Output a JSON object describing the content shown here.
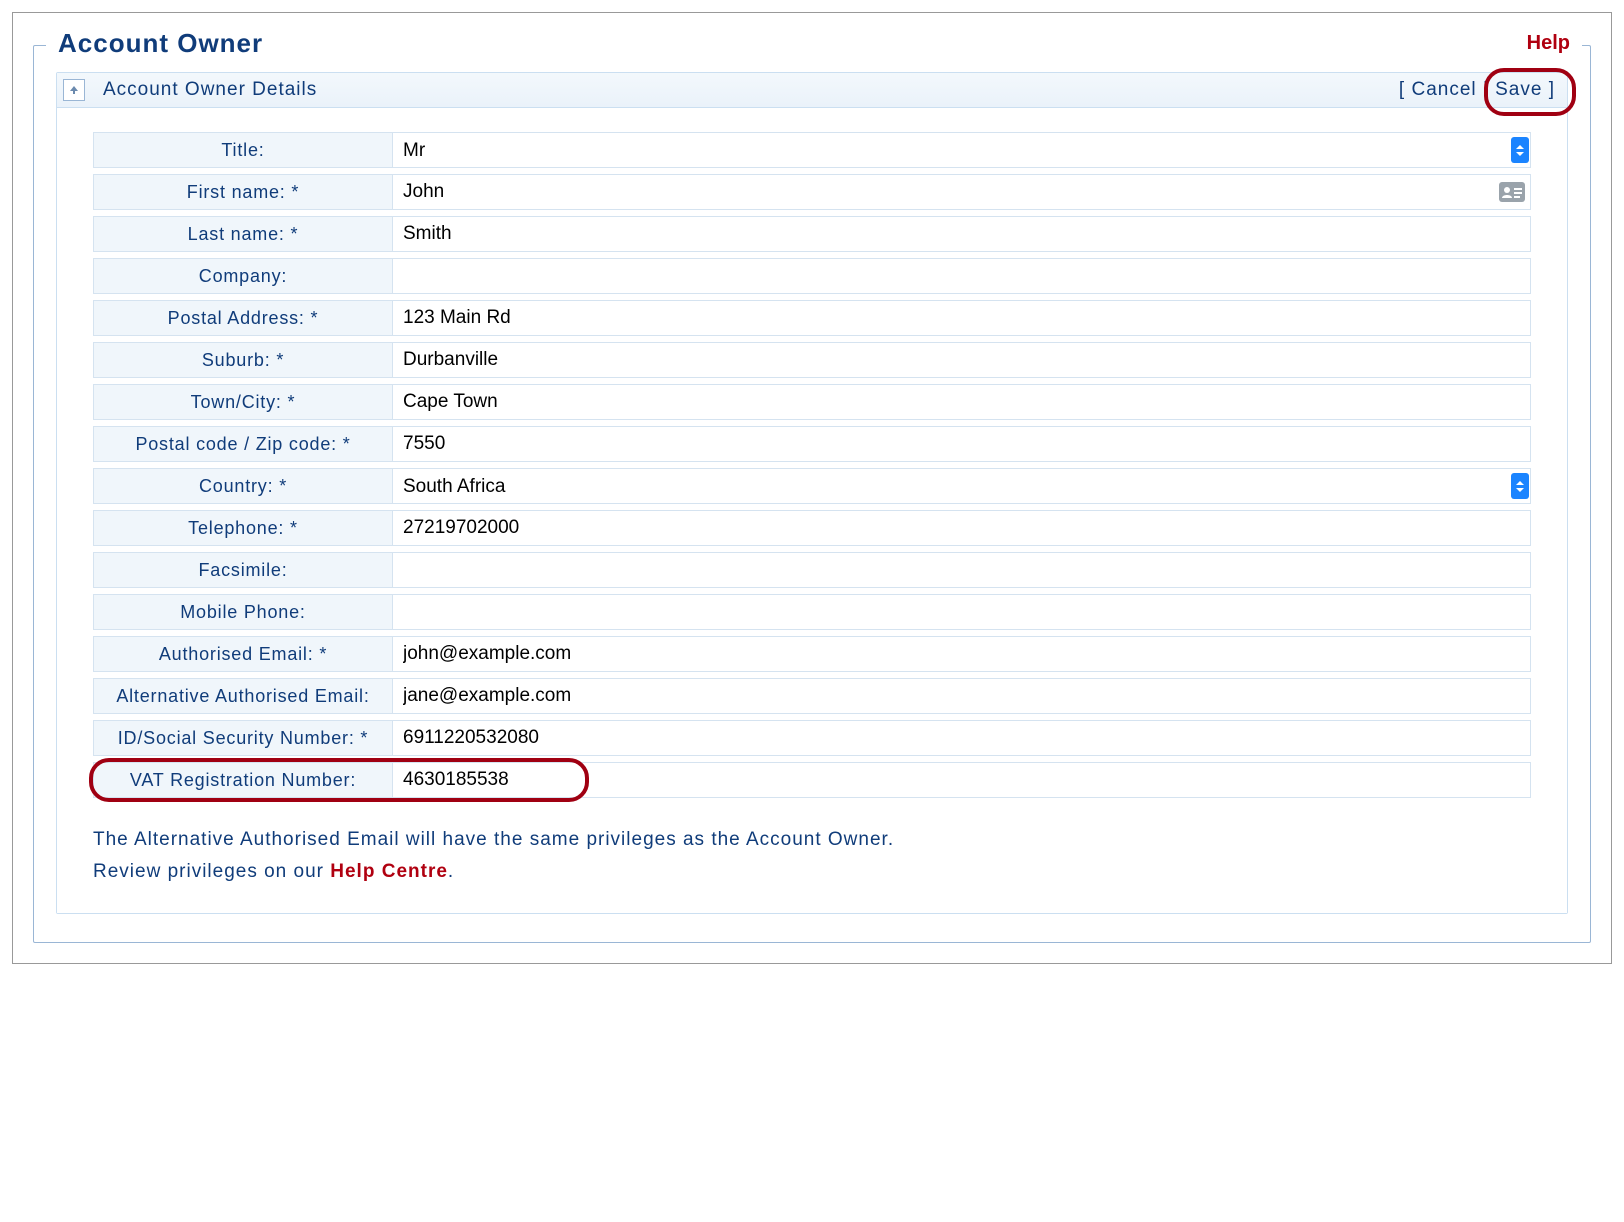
{
  "legend": {
    "title": "Account Owner",
    "help": "Help"
  },
  "panel": {
    "title": "Account Owner Details",
    "cancel": "Cancel",
    "save": "Save"
  },
  "fields": {
    "title": {
      "label": "Title:",
      "value": "Mr"
    },
    "first_name": {
      "label": "First name: *",
      "value": "John"
    },
    "last_name": {
      "label": "Last name: *",
      "value": "Smith"
    },
    "company": {
      "label": "Company:",
      "value": ""
    },
    "postal_address": {
      "label": "Postal Address: *",
      "value": "123 Main Rd"
    },
    "suburb": {
      "label": "Suburb: *",
      "value": "Durbanville"
    },
    "town_city": {
      "label": "Town/City: *",
      "value": "Cape Town"
    },
    "postal_code": {
      "label": "Postal code / Zip code: *",
      "value": "7550"
    },
    "country": {
      "label": "Country: *",
      "value": "South Africa"
    },
    "telephone": {
      "label": "Telephone: *",
      "value": "27219702000"
    },
    "facsimile": {
      "label": "Facsimile:",
      "value": ""
    },
    "mobile_phone": {
      "label": "Mobile Phone:",
      "value": ""
    },
    "authorised_email": {
      "label": "Authorised Email: *",
      "value": "john@example.com"
    },
    "alt_authorised_email": {
      "label": "Alternative Authorised Email:",
      "value": "jane@example.com"
    },
    "id_ssn": {
      "label": "ID/Social Security Number: *",
      "value": "6911220532080"
    },
    "vat": {
      "label": "VAT Registration Number:",
      "value": "4630185538"
    }
  },
  "info": {
    "line1": "The Alternative Authorised Email will have the same privileges as the Account Owner.",
    "line2_prefix": "Review privileges on our ",
    "line2_link": "Help Centre",
    "line2_suffix": "."
  }
}
